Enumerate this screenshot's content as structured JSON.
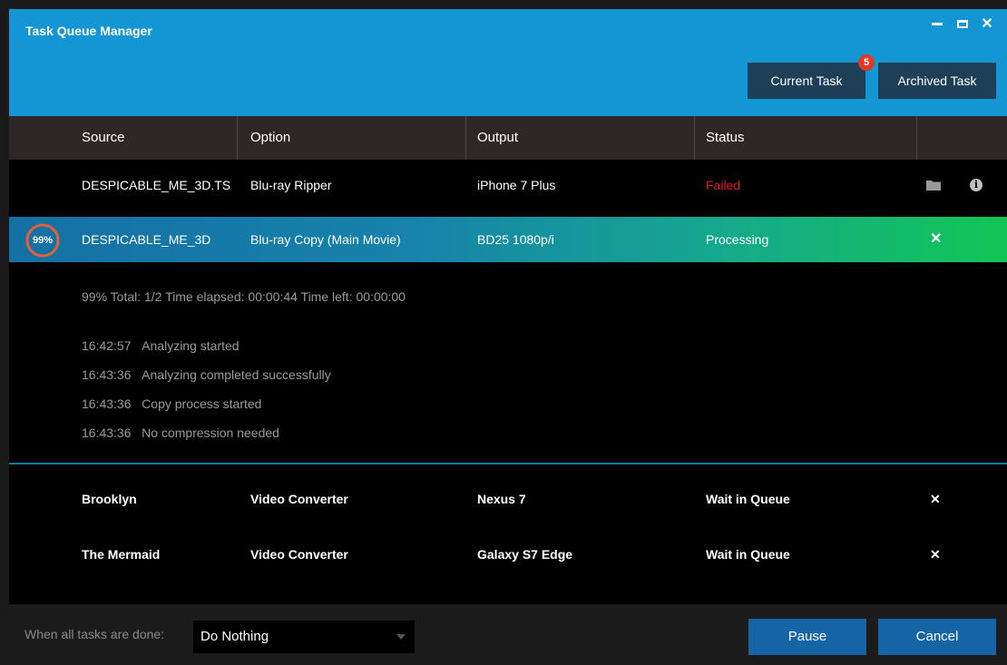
{
  "window": {
    "title": "Task Queue Manager"
  },
  "tabs": {
    "current_label": "Current Task",
    "archived_label": "Archived Task",
    "badge_count": "5"
  },
  "table": {
    "headers": [
      "Source",
      "Option",
      "Output",
      "Status"
    ]
  },
  "tasks": [
    {
      "source": "DESPICABLE_ME_3D.TS",
      "option": "Blu-ray Ripper",
      "output": "iPhone 7 Plus",
      "status": "Failed"
    },
    {
      "source": "DESPICABLE_ME_3D",
      "option": "Blu-ray Copy (Main Movie)",
      "output": "BD25 1080p/i",
      "status": "Processing",
      "progress_label": "99%",
      "progress": 0.99
    }
  ],
  "details": {
    "summary": "99%   Total: 1/2  Time elapsed: 00:00:44  Time left: 00:00:00",
    "log": [
      {
        "time": "16:42:57",
        "message": "Analyzing started"
      },
      {
        "time": "16:43:36",
        "message": "Analyzing completed successfully"
      },
      {
        "time": "16:43:36",
        "message": "Copy process started"
      },
      {
        "time": "16:43:36",
        "message": "No compression needed"
      }
    ]
  },
  "queue": [
    {
      "source": "Brooklyn",
      "option": "Video Converter",
      "output": "Nexus 7",
      "status": "Wait in Queue"
    },
    {
      "source": "The Mermaid",
      "option": "Video Converter",
      "output": "Galaxy S7 Edge",
      "status": "Wait in Queue"
    }
  ],
  "footer": {
    "when_done_label": "When all tasks are done:",
    "when_done_value": "Do Nothing",
    "pause_label": "Pause",
    "cancel_label": "Cancel"
  },
  "colors": {
    "titlebar": "#1596d4",
    "failed": "#e6191c",
    "button": "#1565a6",
    "processing_start": "#1570a4",
    "processing_end": "#12c655"
  },
  "icons": {
    "minimize": "minimize-icon",
    "maximize": "maximize-icon",
    "close": "close-icon",
    "folder": "folder-icon",
    "info": "info-icon",
    "remove": "remove-icon"
  }
}
